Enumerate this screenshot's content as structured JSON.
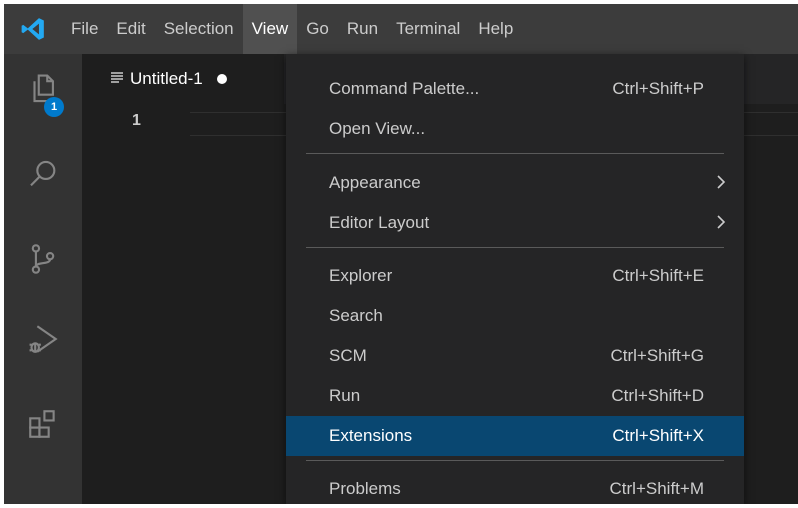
{
  "menubar": {
    "items": [
      {
        "label": "File"
      },
      {
        "label": "Edit"
      },
      {
        "label": "Selection"
      },
      {
        "label": "View"
      },
      {
        "label": "Go"
      },
      {
        "label": "Run"
      },
      {
        "label": "Terminal"
      },
      {
        "label": "Help"
      }
    ],
    "open_item": "View"
  },
  "activitybar": {
    "explorer_badge": "1",
    "icons": [
      "explorer-icon",
      "search-icon",
      "source-control-icon",
      "run-debug-icon",
      "extensions-icon"
    ]
  },
  "editor": {
    "tab": {
      "label": "Untitled-1",
      "dirty": true
    },
    "line_numbers": [
      "1"
    ]
  },
  "view_menu": {
    "items": [
      {
        "label": "Command Palette...",
        "shortcut": "Ctrl+Shift+P"
      },
      {
        "label": "Open View...",
        "shortcut": ""
      },
      {
        "label": "Appearance",
        "shortcut": "",
        "submenu": true
      },
      {
        "label": "Editor Layout",
        "shortcut": "",
        "submenu": true
      },
      {
        "label": "Explorer",
        "shortcut": "Ctrl+Shift+E"
      },
      {
        "label": "Search",
        "shortcut": ""
      },
      {
        "label": "SCM",
        "shortcut": "Ctrl+Shift+G"
      },
      {
        "label": "Run",
        "shortcut": "Ctrl+Shift+D"
      },
      {
        "label": "Extensions",
        "shortcut": "Ctrl+Shift+X",
        "highlighted": true
      },
      {
        "label": "Problems",
        "shortcut": "Ctrl+Shift+M"
      }
    ]
  },
  "colors": {
    "accent": "#007acc",
    "menu_highlight": "#094771",
    "menubar_bg": "#3c3c3c",
    "activitybar_bg": "#333333",
    "editor_bg": "#1e1e1e"
  }
}
